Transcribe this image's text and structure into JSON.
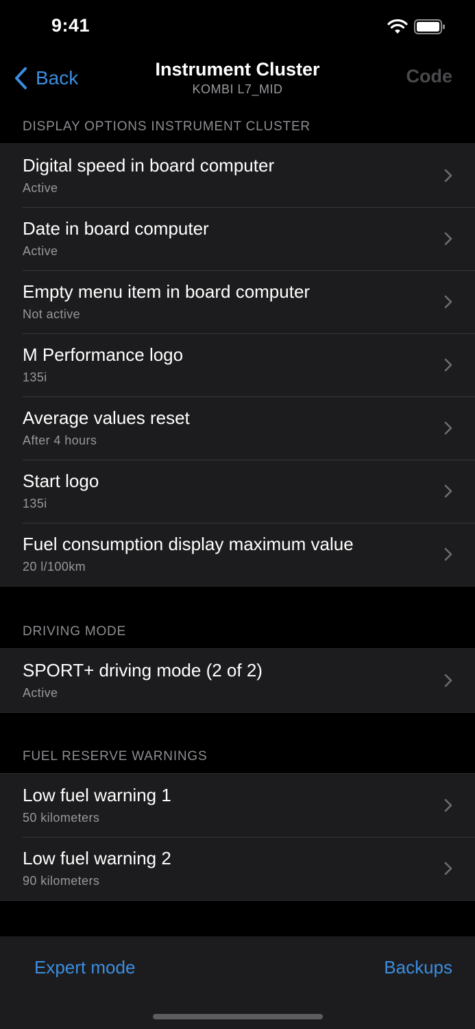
{
  "status_bar": {
    "time": "9:41",
    "icons": [
      "wifi-icon",
      "battery-icon"
    ]
  },
  "nav": {
    "back_label": "Back",
    "title": "Instrument Cluster",
    "subtitle": "KOMBI L7_MID",
    "code_label": "Code"
  },
  "sections": [
    {
      "header": "DISPLAY OPTIONS INSTRUMENT CLUSTER",
      "items": [
        {
          "title": "Digital speed in board computer",
          "value": "Active"
        },
        {
          "title": "Date in board computer",
          "value": "Active"
        },
        {
          "title": "Empty menu item in board computer",
          "value": "Not active"
        },
        {
          "title": "M Performance logo",
          "value": "135i"
        },
        {
          "title": "Average values reset",
          "value": "After 4 hours"
        },
        {
          "title": "Start logo",
          "value": "135i"
        },
        {
          "title": "Fuel consumption display maximum value",
          "value": "20 l/100km"
        }
      ]
    },
    {
      "header": "DRIVING MODE",
      "items": [
        {
          "title": "SPORT+ driving mode (2 of 2)",
          "value": "Active"
        }
      ]
    },
    {
      "header": "FUEL RESERVE WARNINGS",
      "items": [
        {
          "title": "Low fuel warning 1",
          "value": "50 kilometers"
        },
        {
          "title": "Low fuel warning 2",
          "value": "90 kilometers"
        }
      ]
    }
  ],
  "bottom_bar": {
    "expert_label": "Expert mode",
    "backups_label": "Backups"
  },
  "colors": {
    "accent": "#3b8ee0",
    "background": "#000000",
    "cell_background": "#1c1c1e",
    "secondary_text": "#98989d",
    "disabled_text": "#4a4a4d"
  }
}
